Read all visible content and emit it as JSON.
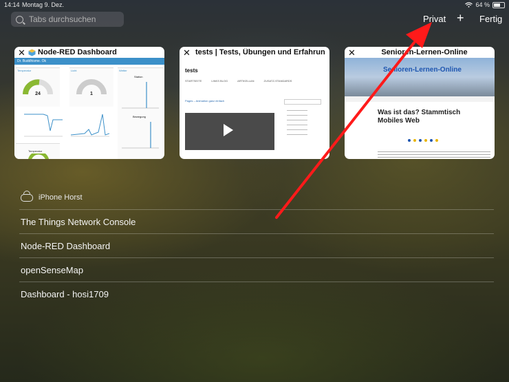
{
  "status": {
    "time": "14:14",
    "date": "Montag 9. Dez.",
    "battery": "64 %",
    "battery_fraction": 0.64
  },
  "search": {
    "placeholder": "Tabs durchsuchen"
  },
  "toolbar": {
    "privat": "Privat",
    "add": "+",
    "done": "Fertig"
  },
  "tabs": [
    {
      "title": "Node-RED Dashboard",
      "close": "✕",
      "icon": "node-red-icon",
      "labels": {
        "bar": "Dr. Buddhisme. Ok",
        "temperature": "Temperatur",
        "light": "Licht",
        "station": "Station",
        "movement": "Bewegung",
        "wetness": "Wetter",
        "temp2": "Temperatur",
        "gauge1": "24",
        "gauge2": "1"
      }
    },
    {
      "title": "tests | Tests, Übungen und Erfahrun…",
      "close": "✕",
      "icon": "wordpress-icon",
      "labels": {
        "site": "tests",
        "link": "Pages – Animation ganz einfach",
        "nav1": "STARTSEITE",
        "nav2": "LINKS BLOG",
        "nav3": "ARTIKELLAN",
        "nav4": "ZUSATZ-STANDARDS"
      }
    },
    {
      "title": "Senioren-Lernen-Online",
      "close": "✕",
      "icon": "site-icon",
      "labels": {
        "banner": "Senioren-Lernen-Online",
        "heading1": "Was ist das? Stammtisch",
        "heading2": "Mobiles Web"
      }
    }
  ],
  "cloud": {
    "device": "iPhone Horst",
    "icon": "cloud-icon"
  },
  "list": [
    "The Things Network Console",
    "Node-RED Dashboard",
    "openSenseMap",
    "Dashboard - hosi1709"
  ],
  "colors": {
    "arrow": "#ff1a1a",
    "accent": "#3c90c9",
    "link": "#1d55b0"
  }
}
